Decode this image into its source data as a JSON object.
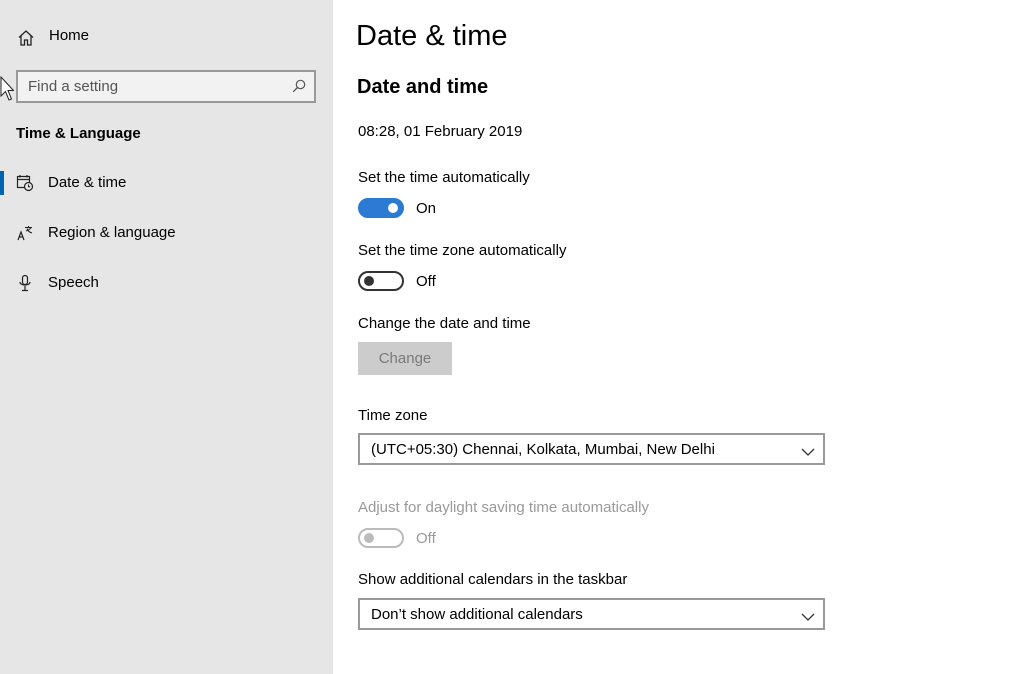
{
  "sidebar": {
    "home_label": "Home",
    "search": {
      "placeholder": "Find a setting"
    },
    "section_title": "Time & Language",
    "items": [
      {
        "label": "Date & time",
        "icon": "calendar-clock-icon",
        "selected": true
      },
      {
        "label": "Region & language",
        "icon": "language-icon",
        "selected": false
      },
      {
        "label": "Speech",
        "icon": "microphone-icon",
        "selected": false
      }
    ],
    "accent_color": "#0063b1"
  },
  "main": {
    "page_title": "Date & time",
    "subheading": "Date and time",
    "current_datetime": "08:28, 01 February 2019",
    "set_time_auto": {
      "label": "Set the time automatically",
      "state": "On",
      "on": true
    },
    "set_timezone_auto": {
      "label": "Set the time zone automatically",
      "state": "Off",
      "on": false
    },
    "change_date_time": {
      "label": "Change the date and time",
      "button_label": "Change",
      "enabled": false
    },
    "time_zone": {
      "label": "Time zone",
      "value": "(UTC+05:30) Chennai, Kolkata, Mumbai, New Delhi"
    },
    "daylight_saving": {
      "label": "Adjust for daylight saving time automatically",
      "state": "Off",
      "on": false,
      "enabled": false
    },
    "additional_calendars": {
      "label": "Show additional calendars in the taskbar",
      "value": "Don’t show additional calendars"
    },
    "toggle_on_color": "#2b7ad4"
  }
}
